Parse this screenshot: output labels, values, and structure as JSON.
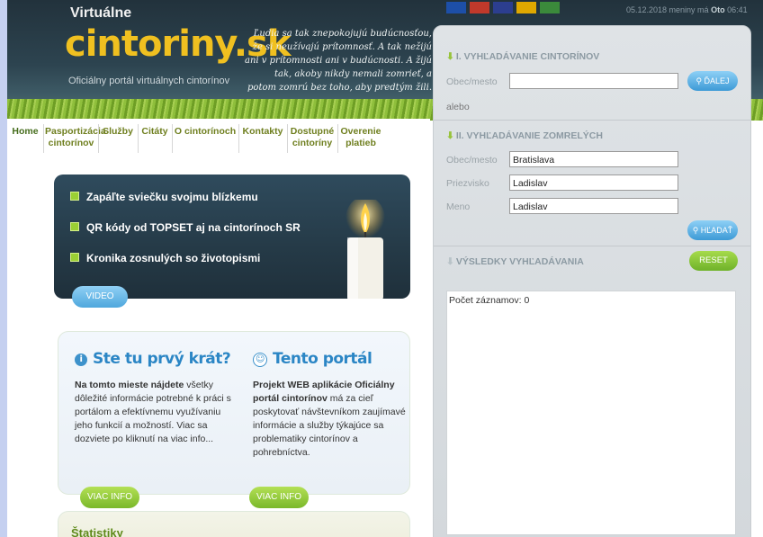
{
  "header": {
    "logo_top": "Virtuálne",
    "logo_main": "cintoriny.sk",
    "logo_sub": "Oficiálny portál virtuálnych cintorínov",
    "quote": "Ľudia sa tak znepokojujú budúcnosťou, že si neužívajú prítomnosť. A tak nežijú ani v prítomnosti ani v budúcnosti. A žijú tak, akoby nikdy nemali zomrieť, a potom zomrú bez toho, aby predtým žili.",
    "date_text": "05.12.2018 meniny má",
    "nameday": "Oto",
    "time": "06:41",
    "flags": [
      {
        "name": "slovak-flag-icon",
        "color": "#1d4fa8"
      },
      {
        "name": "czech-flag-icon",
        "color": "#c0392b"
      },
      {
        "name": "uk-flag-icon",
        "color": "#2c3e8f"
      },
      {
        "name": "german-flag-icon",
        "color": "#e0a800"
      },
      {
        "name": "hungarian-flag-icon",
        "color": "#3b8a3b"
      }
    ]
  },
  "menu": {
    "items": [
      "Home",
      "Pasportizácia cintorínov",
      "Služby",
      "Citáty",
      "O cintorínoch",
      "Kontakty",
      "Dostupné cintoríny",
      "Overenie platieb"
    ]
  },
  "banner": {
    "items": [
      "Zapáľte sviečku svojmu blízkemu",
      "QR kódy od TOPSET aj na cintorínoch SR",
      "Kronika zosnulých so životopismi"
    ],
    "video_label": "VIDEO"
  },
  "info": {
    "left_title": "Ste tu prvý krát?",
    "left_bold": "Na tomto mieste nájdete",
    "left_text": " všetky dôležité informácie potrebné k práci s portálom a efektívnemu využívaniu jeho funkcií a možností. Viac sa dozviete po kliknutí na viac info...",
    "right_title": "Tento portál",
    "right_bold": "Projekt WEB aplikácie Oficiálny portál cintorínov",
    "right_text": " má za cieľ poskytovať návštevníkom zaujímavé informácie a služby týkajúce sa problematiky cintorínov a pohrebníctva.",
    "more_label": "VIAC INFO"
  },
  "stats": {
    "title": "Štatistiky"
  },
  "search": {
    "section1_title": "I. VYHĽADÁVANIE CINTORÍNOV",
    "city_label": "Obec/mesto",
    "city_value": "",
    "next_label": "ĎALEJ",
    "or_label": "alebo",
    "section2_title": "II. VYHĽADÁVANIE ZOMRELÝCH",
    "dead_city_label": "Obec/mesto",
    "dead_city_value": "Bratislava",
    "surname_label": "Priezvisko",
    "surname_value": "Ladislav",
    "firstname_label": "Meno",
    "firstname_value": "Ladislav",
    "search_label": "HĽADAŤ",
    "results_title": "VÝSLEDKY VYHĽADÁVANIA",
    "reset_label": "RESET",
    "count_text": "Počet záznamov: 0"
  }
}
